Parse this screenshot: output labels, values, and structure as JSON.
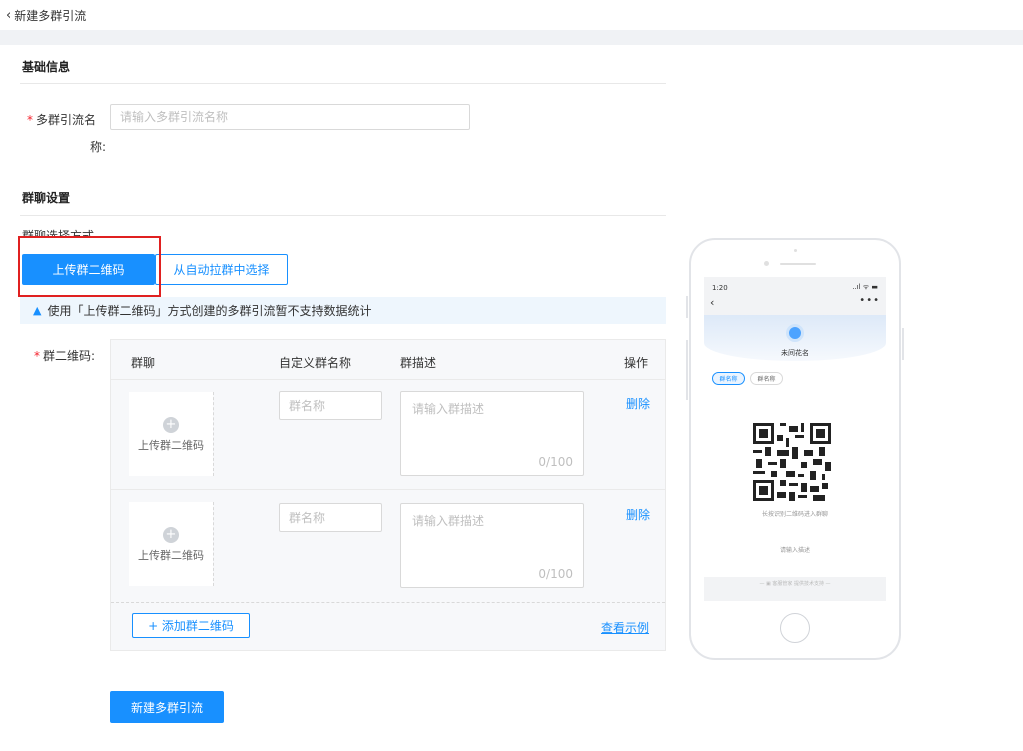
{
  "header": {
    "back_label": "新建多群引流"
  },
  "basic": {
    "title": "基础信息",
    "name_label_line1": "多群引流名",
    "name_label_line2": "称:",
    "name_placeholder": "请输入多群引流名称"
  },
  "group": {
    "title": "群聊设置",
    "method_label": "群聊选择方式",
    "method_options": [
      "上传群二维码",
      "从自动拉群中选择"
    ],
    "selected_method": "上传群二维码",
    "notice": "使用「上传群二维码」方式创建的多群引流暂不支持数据统计",
    "qr_label": "群二维码:",
    "columns": [
      "群聊",
      "自定义群名称",
      "群描述",
      "操作"
    ],
    "rows": [
      {
        "upload_label": "上传群二维码",
        "name_placeholder": "群名称",
        "desc_placeholder": "请输入群描述",
        "counter": "0/100",
        "action": "删除"
      },
      {
        "upload_label": "上传群二维码",
        "name_placeholder": "群名称",
        "desc_placeholder": "请输入群描述",
        "counter": "0/100",
        "action": "删除"
      }
    ],
    "add_button": "+ 添加群二维码",
    "example_link": "查看示例"
  },
  "submit_button": "新建多群引流",
  "preview": {
    "time": "1:20",
    "status_icons": "..ıl ᯤ ▬",
    "more": "•••",
    "card_name": "未间花名",
    "chip_active": "群名称",
    "chip_inactive": "群名称",
    "qr_tip": "长按识别二维码进入群聊",
    "desc_placeholder": "请输入描述",
    "footer": "— ▣ 客服管家 提供技术支持 —"
  },
  "colors": {
    "primary": "#1890ff",
    "required": "#f5222d",
    "highlight": "#e02020",
    "notice_bg": "#eef6fd"
  }
}
